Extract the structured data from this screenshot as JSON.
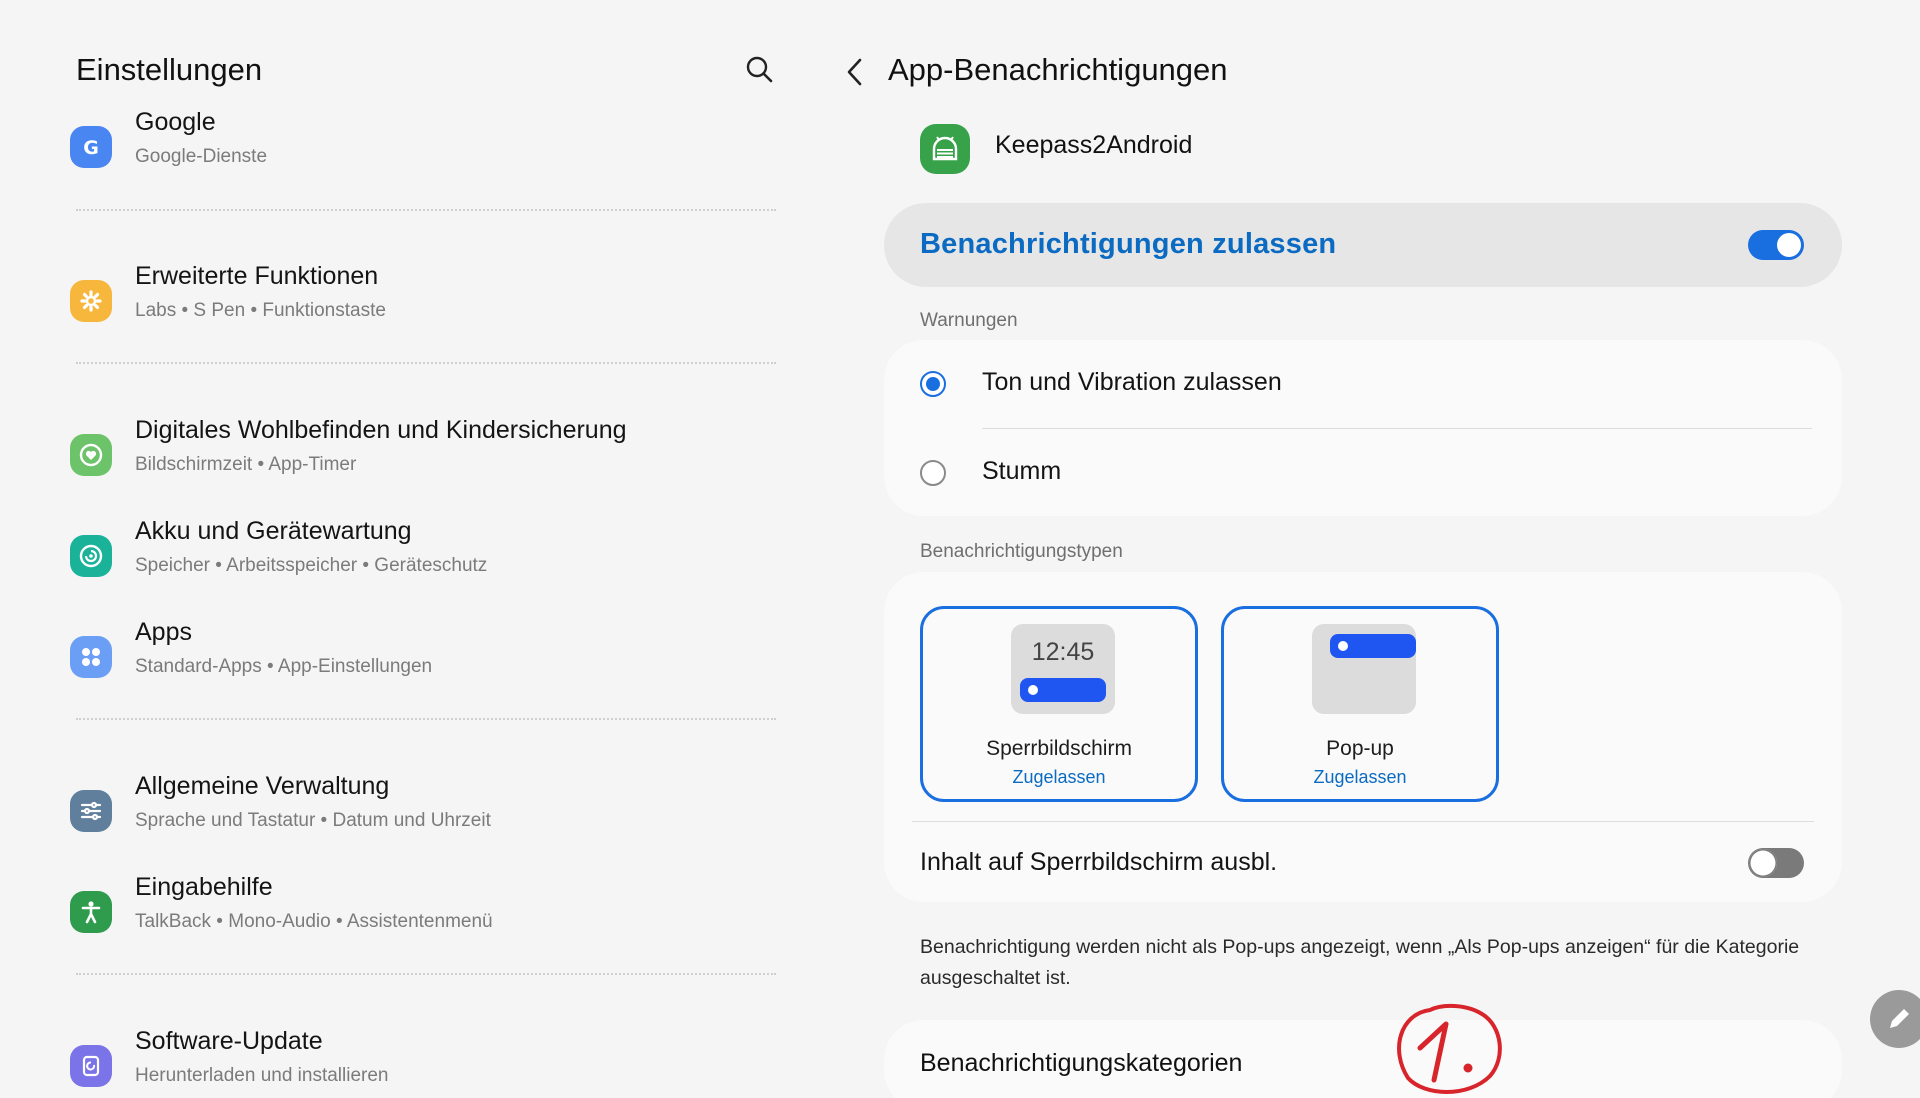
{
  "left": {
    "title": "Einstellungen",
    "search_icon": "search-icon",
    "items": [
      {
        "title": "Google",
        "subtitle": "Google-Dienste",
        "icon": "google-icon",
        "color": "#4a86f2"
      },
      {
        "title": "Erweiterte Funktionen",
        "subtitle": "Labs  •  S Pen  •  Funktionstaste",
        "icon": "advanced-features-icon",
        "color": "#f6b73c"
      },
      {
        "title": "Digitales Wohlbefinden und Kindersicherung",
        "subtitle": "Bildschirmzeit  •  App-Timer",
        "icon": "wellbeing-icon",
        "color": "#6dc36a"
      },
      {
        "title": "Akku und Gerätewartung",
        "subtitle": "Speicher  •  Arbeitsspeicher  •  Geräteschutz",
        "icon": "device-care-icon",
        "color": "#1ab39a"
      },
      {
        "title": "Apps",
        "subtitle": "Standard-Apps  •  App-Einstellungen",
        "icon": "apps-icon",
        "color": "#6b9ff5"
      },
      {
        "title": "Allgemeine Verwaltung",
        "subtitle": "Sprache und Tastatur  •  Datum und Uhrzeit",
        "icon": "general-management-icon",
        "color": "#5f7f9c"
      },
      {
        "title": "Eingabehilfe",
        "subtitle": "TalkBack  •  Mono-Audio  •  Assistentenmenü",
        "icon": "accessibility-icon",
        "color": "#2f9b4c"
      },
      {
        "title": "Software-Update",
        "subtitle": "Herunterladen und installieren",
        "icon": "software-update-icon",
        "color": "#7b74e8"
      }
    ]
  },
  "right": {
    "back_icon": "back-arrow-icon",
    "title": "App-Benachrichtigungen",
    "app_name": "Keepass2Android",
    "allow_notifications": {
      "label": "Benachrichtigungen zulassen",
      "enabled": true
    },
    "warnings": {
      "label": "Warnungen",
      "options": [
        {
          "label": "Ton und Vibration zulassen",
          "selected": true
        },
        {
          "label": "Stumm",
          "selected": false
        }
      ]
    },
    "types": {
      "label": "Benachrichtigungstypen",
      "items": [
        {
          "name": "Sperrbildschirm",
          "status": "Zugelassen",
          "clock": "12:45"
        },
        {
          "name": "Pop-up",
          "status": "Zugelassen"
        }
      ],
      "hide_content": {
        "label": "Inhalt auf Sperrbildschirm ausbl.",
        "enabled": false
      }
    },
    "note": "Benachrichtigung werden nicht als Pop-ups angezeigt, wenn „Als Pop-ups anzeigen“ für die Kategorie ausgeschaltet ist.",
    "categories_label": "Benachrichtigungskategorien",
    "annotation": "1.",
    "annotation_color": "#d8242b",
    "edit_icon": "pencil-icon",
    "accent_color": "#1a6fe0"
  }
}
